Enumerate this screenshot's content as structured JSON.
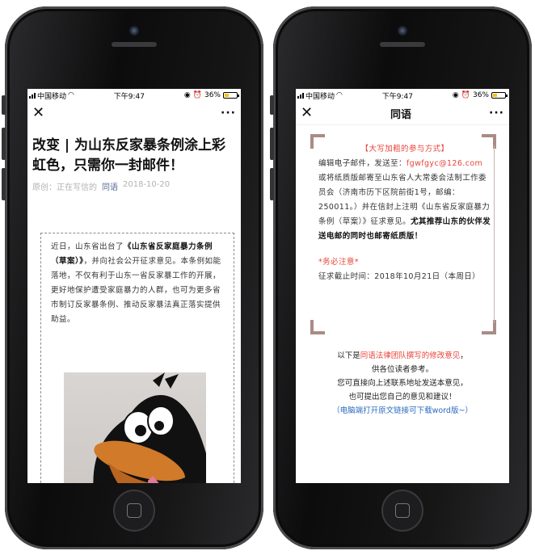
{
  "left": {
    "status": {
      "carrier": "中国移动",
      "time": "下午9:47",
      "battery": "36%"
    },
    "nav": {
      "close": "✕",
      "more": "···"
    },
    "title": "改变 | 为山东反家暴条例涂上彩虹色，只需你一封邮件！",
    "meta": {
      "origin": "原创：",
      "author": "正在写信的",
      "source": "同语",
      "date": "2018-10-20"
    },
    "body": {
      "p1": "近日，山东省出台了",
      "p1_bold": "《山东省反家庭暴力条例（草案）》",
      "p1_rest": "，并向社会公开征求意见。本条例如能落地，不仅有利于山东一省反家暴工作的开展，更好地保护遭受家庭暴力的人群，也可为更多省市制订反家暴条例、推动反家暴法真正落实提供助益。"
    },
    "image_desc": "duck-cartoon"
  },
  "right": {
    "status": {
      "carrier": "中国移动",
      "time": "下午9:47",
      "battery": "36%"
    },
    "nav": {
      "close": "✕",
      "title": "同语",
      "more": "···"
    },
    "frame": {
      "heading": "【大写加粗的参与方式】",
      "email_prefix": "编辑电子邮件，发送至：",
      "email": "fgwfgyc@126.com",
      "mail_text": "或将纸质版邮寄至山东省人大常委会法制工作委员会（济南市历下区院前街1号，邮编：250011。）并在信封上注明《山东省反家庭暴力条例（草案）》征求意见。",
      "mail_bold": "尤其推荐山东的伙伴发送电邮的同时也邮寄纸质版！",
      "notice": "*务必注意*",
      "deadline": "征求截止时间：2018年10月21日（本周日）"
    },
    "below": {
      "line1_a": "以下是",
      "line1_red": "同语法律团队撰写的修改意见",
      "line1_b": "，",
      "line2": "供各位读者参考。",
      "line3": "您可直接向上述联系地址发送本意见，",
      "line4": "也可提出您自己的意见和建议！",
      "line5": "（电脑端打开原文链接可下载word版~）"
    }
  }
}
